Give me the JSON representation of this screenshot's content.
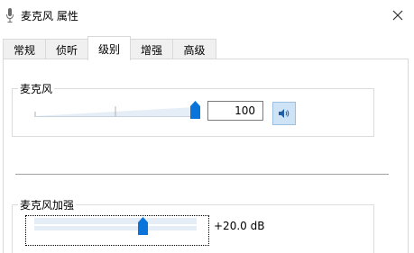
{
  "window": {
    "title": "麦克风 属性",
    "icon": "microphone-icon",
    "close_icon": "close-icon"
  },
  "tabs": [
    {
      "label": "常规",
      "active": false
    },
    {
      "label": "侦听",
      "active": false
    },
    {
      "label": "级别",
      "active": true
    },
    {
      "label": "增强",
      "active": false
    },
    {
      "label": "高级",
      "active": false
    }
  ],
  "microphone": {
    "group_label": "麦克风",
    "level_value": "100",
    "level_fraction": 1.0,
    "mute_icon": "speaker-icon"
  },
  "boost": {
    "group_label": "麦克风加强",
    "value_text": "+20.0 dB",
    "level_fraction": 0.667
  },
  "colors": {
    "accent": "#0a74da",
    "track": "#e5eef6"
  }
}
